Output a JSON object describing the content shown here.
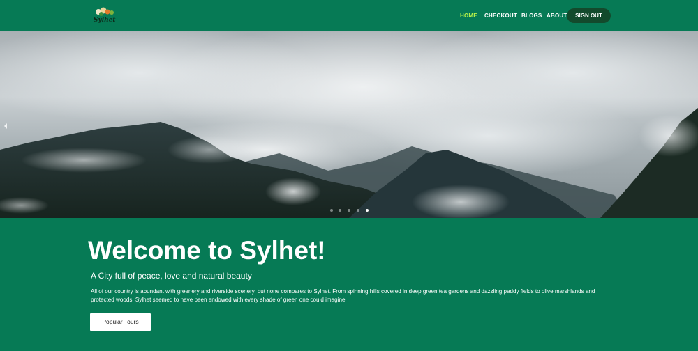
{
  "header": {
    "logo_text": "Sylhet",
    "logo_icon": "sylhet-tourism-logo-icon",
    "nav": [
      {
        "label": "HOME",
        "active": true
      },
      {
        "label": "CHECKOUT",
        "active": false
      },
      {
        "label": "BLOGS",
        "active": false
      },
      {
        "label": "ABOUT",
        "active": false
      }
    ],
    "signout_label": "SIGN OUT"
  },
  "hero": {
    "prev_icon": "chevron-left-icon",
    "slide_count": 5,
    "active_slide": 5
  },
  "content": {
    "title": "Welcome to Sylhet!",
    "subtitle": "A City full of peace, love and natural beauty",
    "body": "All of our country is abundant with greenery and riverside scenery, but none compares to Sylhet. From spinning hills covered in deep green tea gardens and dazzling paddy fields to olive marshlands and protected woods, Sylhet seemed to have been endowed with every shade of green one could imagine.",
    "button_label": "Popular Tours"
  },
  "colors": {
    "brand_green": "#067a55",
    "active_nav": "#b8f24a",
    "signout_bg": "#134a2c"
  }
}
